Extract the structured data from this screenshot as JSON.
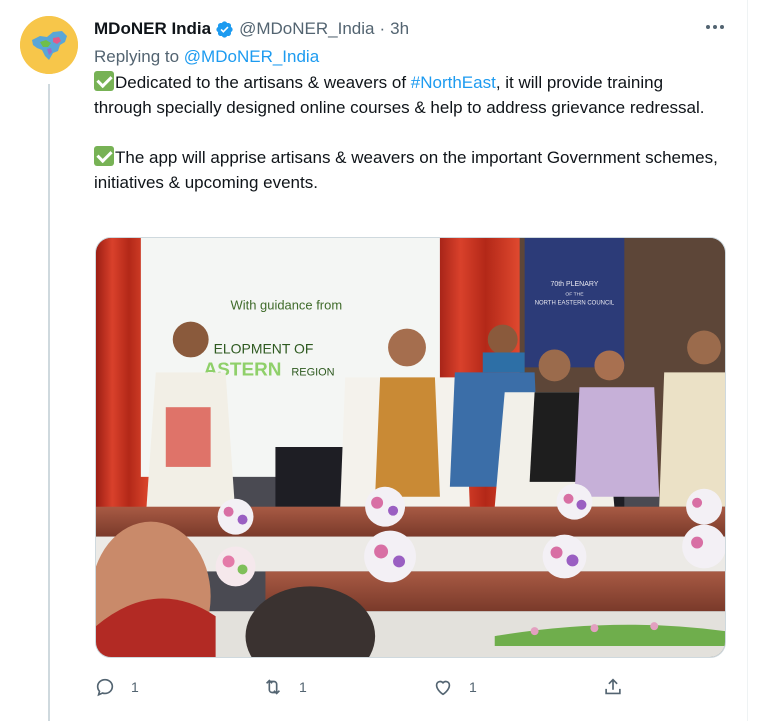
{
  "tweet": {
    "author_name": "MDoNER India",
    "author_handle": "@MDoNER_India",
    "separator": "·",
    "time": "3h",
    "replying_prefix": "Replying to",
    "replying_handle": "@MDoNER_India",
    "p1_before": "Dedicated to the artisans & weavers of ",
    "p1_hashtag": "#NorthEast",
    "p1_after": ", it will provide training through specially designed online courses & help to address grievance redressal.",
    "p2_text": "The app will apprise artisans & weavers on the important Government schemes, initiatives & upcoming events."
  },
  "media": {
    "banner_line1": "With guidance from",
    "banner_line2a": "ELOPMENT OF",
    "banner_line3a": "ASTERN",
    "banner_line3b": "REGION",
    "board_line1": "70th PLENARY",
    "board_line2": "OF THE",
    "board_line3": "NORTH EASTERN COUNCIL"
  },
  "actions": {
    "reply_count": "1",
    "retweet_count": "1",
    "like_count": "1"
  },
  "icons": {
    "verified": "verified-badge-icon",
    "more": "more-options-icon",
    "reply": "reply-icon",
    "retweet": "retweet-icon",
    "like": "heart-icon",
    "share": "share-icon",
    "check": "check-mark-icon"
  },
  "colors": {
    "accent": "#1d9bf0",
    "muted": "#536471",
    "check_green": "#77b255"
  }
}
